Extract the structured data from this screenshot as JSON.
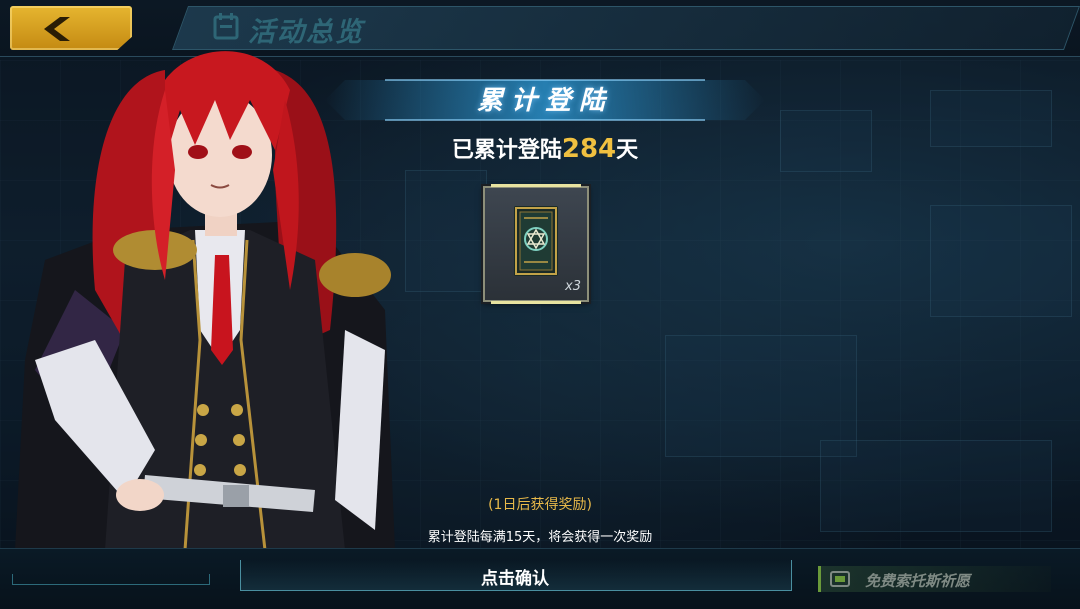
{
  "header": {
    "title": "活动总览",
    "back_icon": "chevron-left-icon"
  },
  "event": {
    "title": "累计登陆",
    "summary_prefix": "已累计登陆",
    "days": "284",
    "summary_suffix": "天"
  },
  "reward": {
    "icon": "tarot-card-icon",
    "quantity": "x3"
  },
  "notes": {
    "countdown": "(1日后获得奖励)",
    "rule": "累计登陆每满15天，将会获得一次奖励"
  },
  "footer": {
    "confirm_label": "点击确认",
    "pray_label": "免费索托斯祈愿"
  },
  "colors": {
    "accent_gold": "#f0c040",
    "countdown_orange": "#e8b94a",
    "back_button_yellow": "#e6b630"
  }
}
